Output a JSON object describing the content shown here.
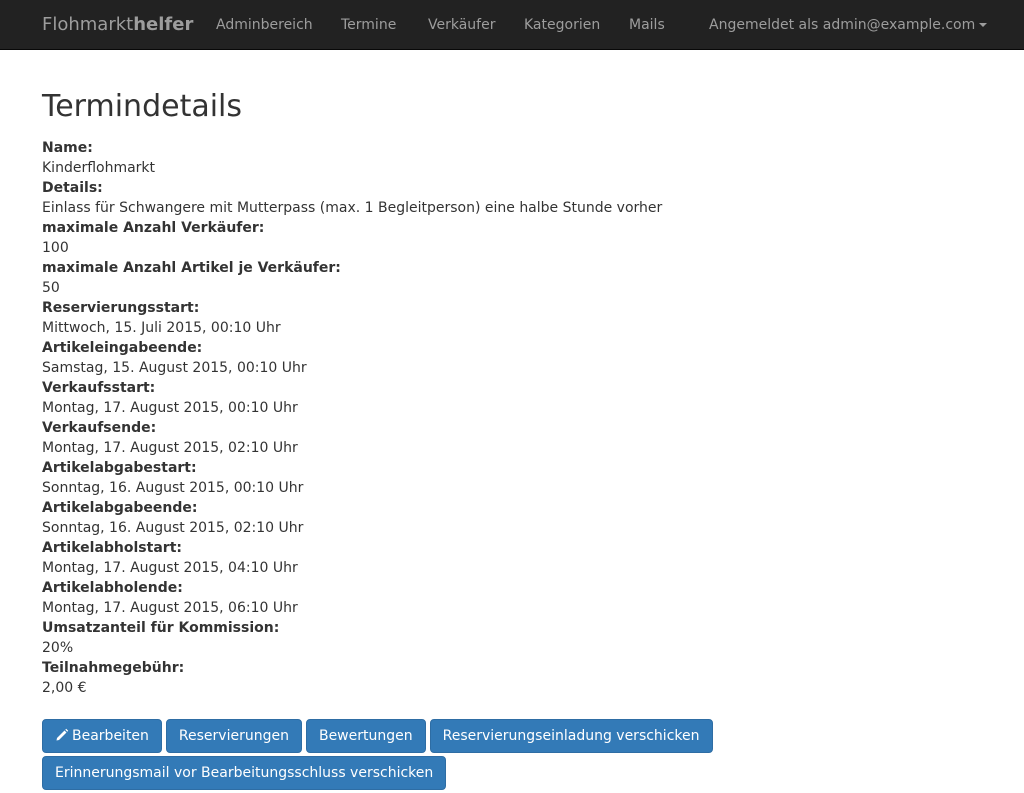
{
  "navbar": {
    "brand_light": "Flohmarkt",
    "brand_bold": "helfer",
    "items": [
      {
        "label": "Adminbereich"
      },
      {
        "label": "Termine"
      },
      {
        "label": "Verkäufer"
      },
      {
        "label": "Kategorien"
      },
      {
        "label": "Mails"
      }
    ],
    "user_menu": "Angemeldet als admin@example.com"
  },
  "page": {
    "title": "Termindetails",
    "details": [
      {
        "label": "Name:",
        "value": "Kinderflohmarkt"
      },
      {
        "label": "Details:",
        "value": "Einlass für Schwangere mit Mutterpass (max. 1 Begleitperson) eine halbe Stunde vorher"
      },
      {
        "label": "maximale Anzahl Verkäufer:",
        "value": "100"
      },
      {
        "label": "maximale Anzahl Artikel je Verkäufer:",
        "value": "50"
      },
      {
        "label": "Reservierungsstart:",
        "value": "Mittwoch, 15. Juli 2015, 00:10 Uhr"
      },
      {
        "label": "Artikeleingabeende:",
        "value": "Samstag, 15. August 2015, 00:10 Uhr"
      },
      {
        "label": "Verkaufsstart:",
        "value": "Montag, 17. August 2015, 00:10 Uhr"
      },
      {
        "label": "Verkaufsende:",
        "value": "Montag, 17. August 2015, 02:10 Uhr"
      },
      {
        "label": "Artikelabgabestart:",
        "value": "Sonntag, 16. August 2015, 00:10 Uhr"
      },
      {
        "label": "Artikelabgabeende:",
        "value": "Sonntag, 16. August 2015, 02:10 Uhr"
      },
      {
        "label": "Artikelabholstart:",
        "value": "Montag, 17. August 2015, 04:10 Uhr"
      },
      {
        "label": "Artikelabholende:",
        "value": "Montag, 17. August 2015, 06:10 Uhr"
      },
      {
        "label": "Umsatzanteil für Kommission:",
        "value": "20%"
      },
      {
        "label": "Teilnahmegebühr:",
        "value": "2,00 €"
      }
    ],
    "buttons": {
      "edit": "Bearbeiten",
      "reservations": "Reservierungen",
      "ratings": "Bewertungen",
      "send_invitation": "Reservierungseinladung verschicken",
      "send_reminder": "Erinnerungsmail vor Bearbeitungsschluss verschicken"
    }
  },
  "colors": {
    "navbar_bg": "#222222",
    "navbar_text": "#9d9d9d",
    "primary_button": "#337ab7"
  }
}
